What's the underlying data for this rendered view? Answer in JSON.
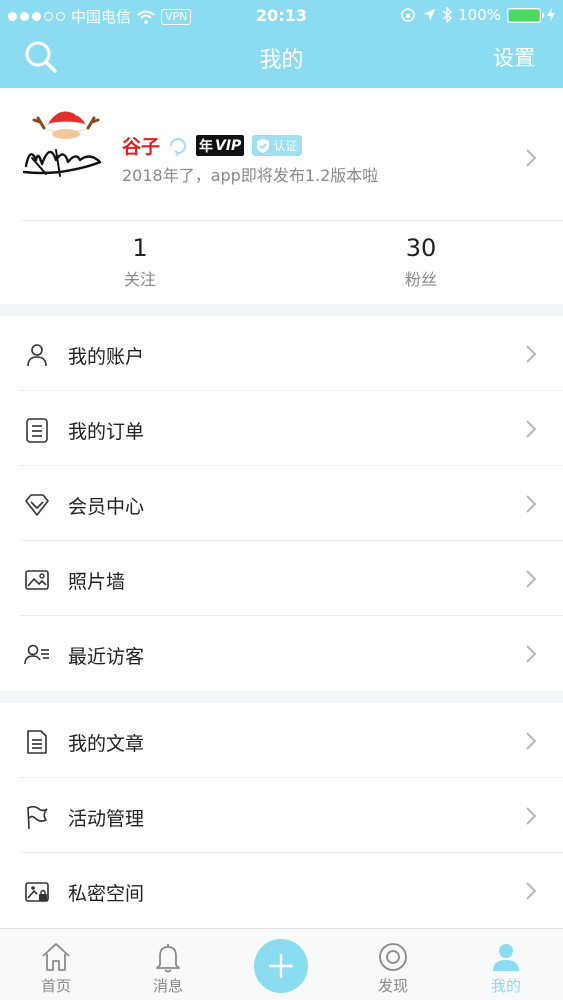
{
  "status_bar": {
    "carrier": "中国电信",
    "vpn": "VPN",
    "time": "20:13",
    "battery": "100%"
  },
  "nav": {
    "title": "我的",
    "settings_label": "设置"
  },
  "profile": {
    "name": "谷子",
    "vip_prefix": "年",
    "vip_label": "VIP",
    "verified_label": "认证",
    "bio": "2018年了，app即将发布1.2版本啦",
    "stats": [
      {
        "value": "1",
        "label": "关注"
      },
      {
        "value": "30",
        "label": "粉丝"
      }
    ]
  },
  "menu_group_1": [
    {
      "label": "我的账户",
      "icon": "user-icon"
    },
    {
      "label": "我的订单",
      "icon": "order-icon"
    },
    {
      "label": "会员中心",
      "icon": "diamond-icon"
    },
    {
      "label": "照片墙",
      "icon": "photo-icon"
    },
    {
      "label": "最近访客",
      "icon": "visitor-icon"
    }
  ],
  "menu_group_2": [
    {
      "label": "我的文章",
      "icon": "article-icon"
    },
    {
      "label": "活动管理",
      "icon": "flag-icon"
    },
    {
      "label": "私密空间",
      "icon": "private-icon"
    }
  ],
  "tabbar": {
    "items": [
      {
        "label": "首页",
        "icon": "home-icon"
      },
      {
        "label": "消息",
        "icon": "bell-icon"
      },
      {
        "label": "",
        "icon": "plus-icon"
      },
      {
        "label": "发现",
        "icon": "discover-icon"
      },
      {
        "label": "我的",
        "icon": "me-icon"
      }
    ],
    "active_index": 4
  },
  "colors": {
    "accent": "#8bdcf0",
    "name_red": "#e02020"
  }
}
